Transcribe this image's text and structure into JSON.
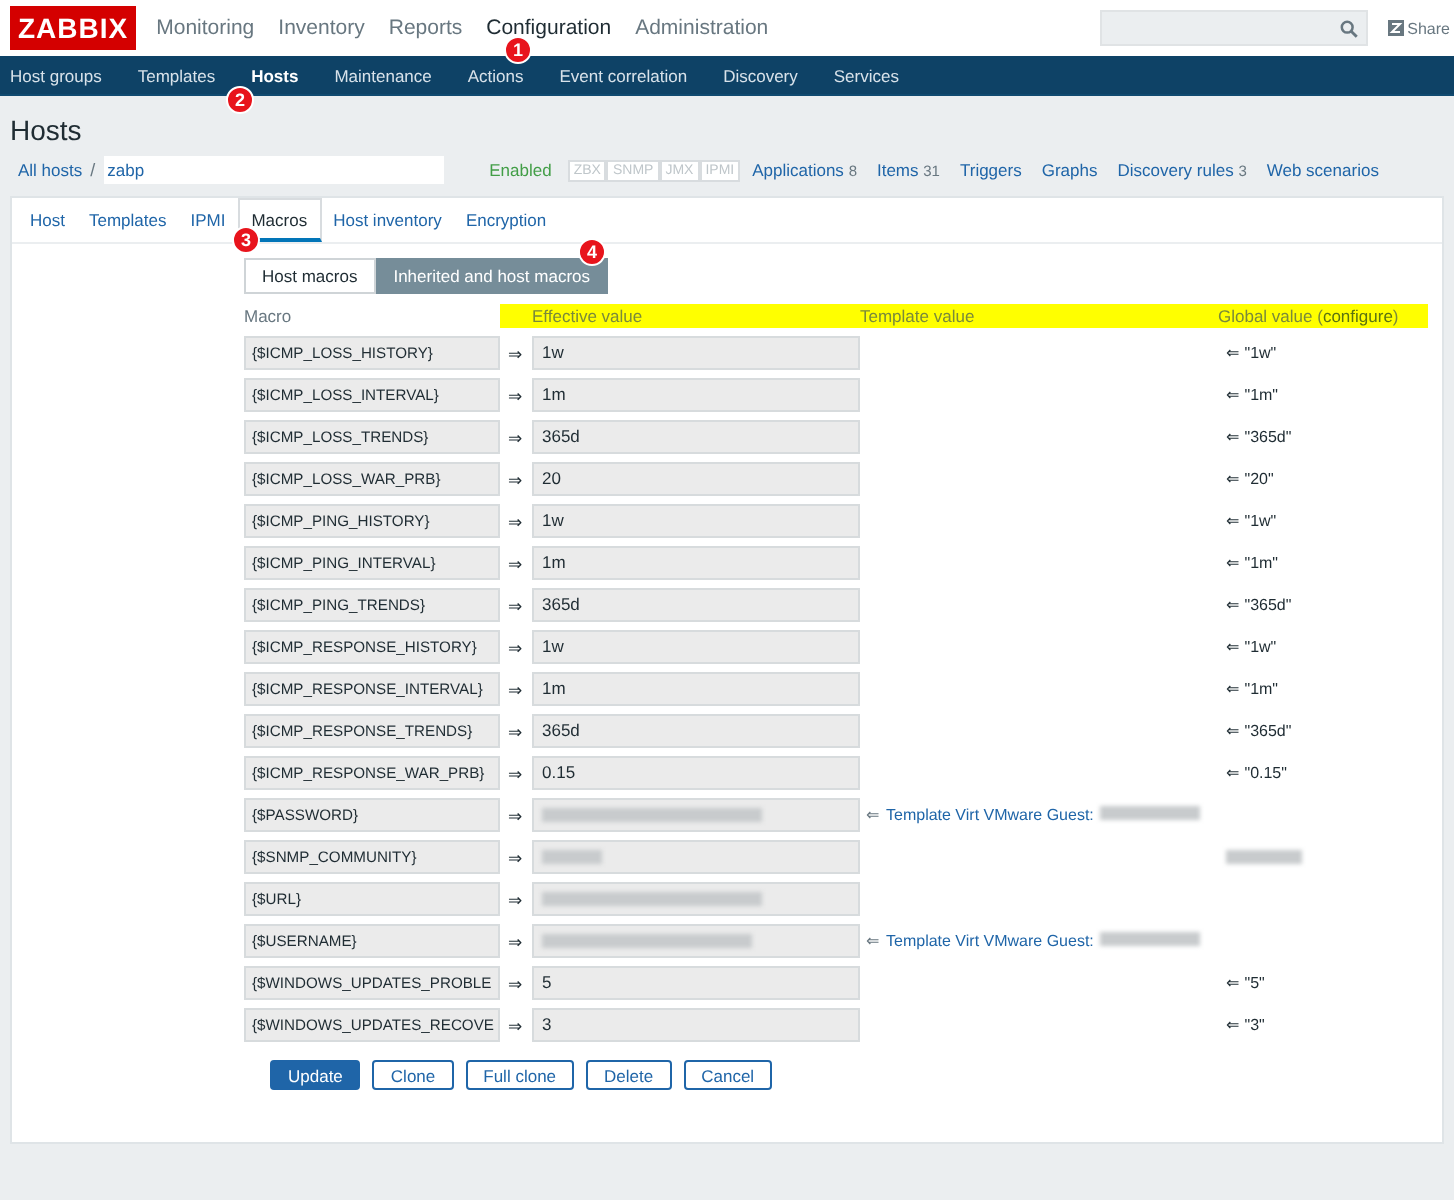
{
  "header": {
    "logo": "ZABBIX",
    "menu": [
      {
        "label": "Monitoring",
        "selected": false
      },
      {
        "label": "Inventory",
        "selected": false
      },
      {
        "label": "Reports",
        "selected": false
      },
      {
        "label": "Configuration",
        "selected": true
      },
      {
        "label": "Administration",
        "selected": false
      }
    ],
    "share": "Share"
  },
  "submenu": [
    {
      "label": "Host groups",
      "selected": false
    },
    {
      "label": "Templates",
      "selected": false
    },
    {
      "label": "Hosts",
      "selected": true
    },
    {
      "label": "Maintenance",
      "selected": false
    },
    {
      "label": "Actions",
      "selected": false
    },
    {
      "label": "Event correlation",
      "selected": false
    },
    {
      "label": "Discovery",
      "selected": false
    },
    {
      "label": "Services",
      "selected": false
    }
  ],
  "page_title": "Hosts",
  "breadcrumb": {
    "root": "All hosts",
    "separator": "/",
    "host": "zabp"
  },
  "status": "Enabled",
  "availability": [
    "ZBX",
    "SNMP",
    "JMX",
    "IPMI"
  ],
  "host_links": [
    {
      "label": "Applications",
      "count": "8"
    },
    {
      "label": "Items",
      "count": "31"
    },
    {
      "label": "Triggers"
    },
    {
      "label": "Graphs"
    },
    {
      "label": "Discovery rules",
      "count": "3"
    },
    {
      "label": "Web scenarios"
    }
  ],
  "tabs": [
    {
      "label": "Host",
      "selected": false
    },
    {
      "label": "Templates",
      "selected": false
    },
    {
      "label": "IPMI",
      "selected": false
    },
    {
      "label": "Macros",
      "selected": true
    },
    {
      "label": "Host inventory",
      "selected": false
    },
    {
      "label": "Encryption",
      "selected": false
    }
  ],
  "macro_modes": [
    {
      "label": "Host macros",
      "selected": false
    },
    {
      "label": "Inherited and host macros",
      "selected": true
    }
  ],
  "columns": {
    "macro": "Macro",
    "effective": "Effective value",
    "template": "Template value",
    "global_prefix": "Global value (",
    "configure": "configure",
    "global_suffix": ")",
    "highlight": true
  },
  "rows": [
    {
      "macro": "{$ICMP_LOSS_HISTORY}",
      "arrow": "⇒",
      "value": "1w",
      "global": "⇐ \"1w\""
    },
    {
      "macro": "{$ICMP_LOSS_INTERVAL}",
      "arrow": "⇒",
      "value": "1m",
      "global": "⇐ \"1m\""
    },
    {
      "macro": "{$ICMP_LOSS_TRENDS}",
      "arrow": "⇒",
      "value": "365d",
      "global": "⇐ \"365d\""
    },
    {
      "macro": "{$ICMP_LOSS_WAR_PRB}",
      "arrow": "⇒",
      "value": "20",
      "global": "⇐ \"20\""
    },
    {
      "macro": "{$ICMP_PING_HISTORY}",
      "arrow": "⇒",
      "value": "1w",
      "global": "⇐ \"1w\""
    },
    {
      "macro": "{$ICMP_PING_INTERVAL}",
      "arrow": "⇒",
      "value": "1m",
      "global": "⇐ \"1m\""
    },
    {
      "macro": "{$ICMP_PING_TRENDS}",
      "arrow": "⇒",
      "value": "365d",
      "global": "⇐ \"365d\""
    },
    {
      "macro": "{$ICMP_RESPONSE_HISTORY}",
      "arrow": "⇒",
      "value": "1w",
      "global": "⇐ \"1w\""
    },
    {
      "macro": "{$ICMP_RESPONSE_INTERVAL}",
      "arrow": "⇒",
      "value": "1m",
      "global": "⇐ \"1m\""
    },
    {
      "macro": "{$ICMP_RESPONSE_TRENDS}",
      "arrow": "⇒",
      "value": "365d",
      "global": "⇐ \"365d\""
    },
    {
      "macro": "{$ICMP_RESPONSE_WAR_PRB}",
      "arrow": "⇒",
      "value": "0.15",
      "global": "⇐ \"0.15\""
    },
    {
      "macro": "{$PASSWORD}",
      "arrow": "⇒",
      "value_redacted": true,
      "template_arrow": "⇐",
      "template": "Template Virt VMware Guest:"
    },
    {
      "macro": "{$SNMP_COMMUNITY}",
      "arrow": "⇒",
      "value_redacted": true,
      "global_redacted": true
    },
    {
      "macro": "{$URL}",
      "arrow": "⇒",
      "value_redacted": true
    },
    {
      "macro": "{$USERNAME}",
      "arrow": "⇒",
      "value_redacted": true,
      "template_arrow": "⇐",
      "template": "Template Virt VMware Guest:"
    },
    {
      "macro": "{$WINDOWS_UPDATES_PROBLE",
      "arrow": "⇒",
      "value": "5",
      "global": "⇐ \"5\""
    },
    {
      "macro": "{$WINDOWS_UPDATES_RECOVE",
      "arrow": "⇒",
      "value": "3",
      "global": "⇐ \"3\""
    }
  ],
  "buttons": [
    {
      "label": "Update",
      "kind": "primary"
    },
    {
      "label": "Clone",
      "kind": "secondary"
    },
    {
      "label": "Full clone",
      "kind": "secondary"
    },
    {
      "label": "Delete",
      "kind": "secondary"
    },
    {
      "label": "Cancel",
      "kind": "secondary"
    }
  ],
  "callouts": [
    "1",
    "2",
    "3",
    "4"
  ]
}
